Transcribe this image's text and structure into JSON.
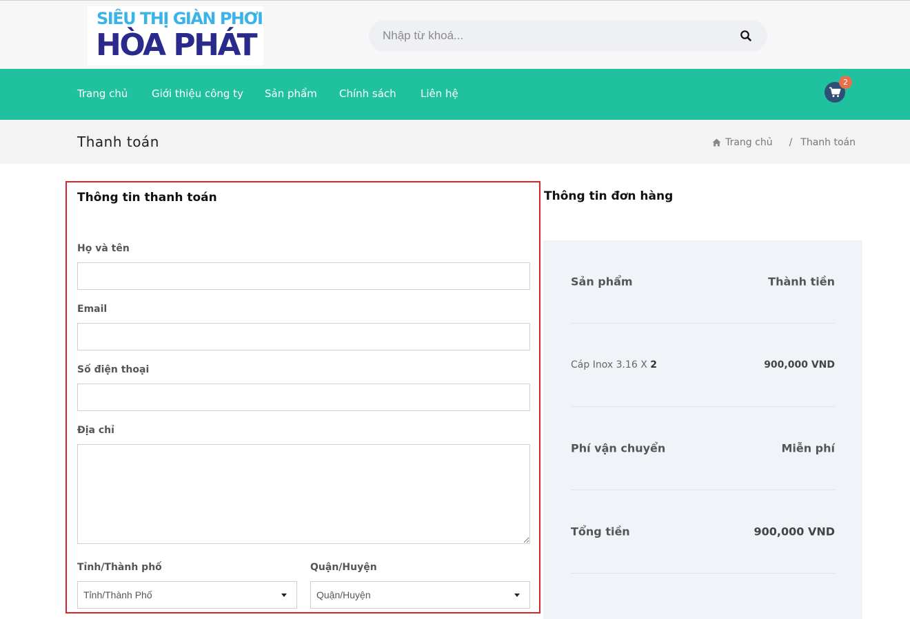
{
  "header": {
    "logo": {
      "line1": "SIÊU THỊ GIÀN PHƠI",
      "line2": "HÒA PHÁT"
    },
    "search": {
      "placeholder": "Nhập từ khoá...",
      "value": ""
    }
  },
  "nav": {
    "items": [
      "Trang chủ",
      "Giới thiệu công ty",
      "Sản phẩm",
      "Chính sách",
      "Liên hệ"
    ],
    "cart_count": "2"
  },
  "titlebar": {
    "title": "Thanh toán",
    "breadcrumb": {
      "home": "Trang chủ",
      "separator": "/",
      "current": "Thanh toán"
    }
  },
  "billing": {
    "heading": "Thông tin thanh toán",
    "fields": {
      "name": {
        "label": "Họ và tên",
        "value": ""
      },
      "email": {
        "label": "Email",
        "value": ""
      },
      "phone": {
        "label": "Số điện thoại",
        "value": ""
      },
      "address": {
        "label": "Địa chỉ",
        "value": ""
      },
      "province": {
        "label": "Tỉnh/Thành phố",
        "selected": "Tỉnh/Thành Phố"
      },
      "district": {
        "label": "Quận/Huyện",
        "selected": "Quận/Huyện"
      }
    }
  },
  "order": {
    "heading": "Thông tin đơn hàng",
    "col_product": "Sản phẩm",
    "col_amount": "Thành tiền",
    "items": [
      {
        "name": "Cáp Inox 3.16",
        "qty_prefix": "X",
        "qty": "2",
        "amount": "900,000 VND"
      }
    ],
    "shipping_label": "Phí vận chuyển",
    "shipping_value": "Miễn phí",
    "total_label": "Tổng tiền",
    "total_value": "900,000 VND"
  },
  "colors": {
    "nav_bg": "#20c19e",
    "highlight_border": "#d9232b",
    "cart_bg": "#2f4f76",
    "badge_bg": "#e8704a"
  }
}
